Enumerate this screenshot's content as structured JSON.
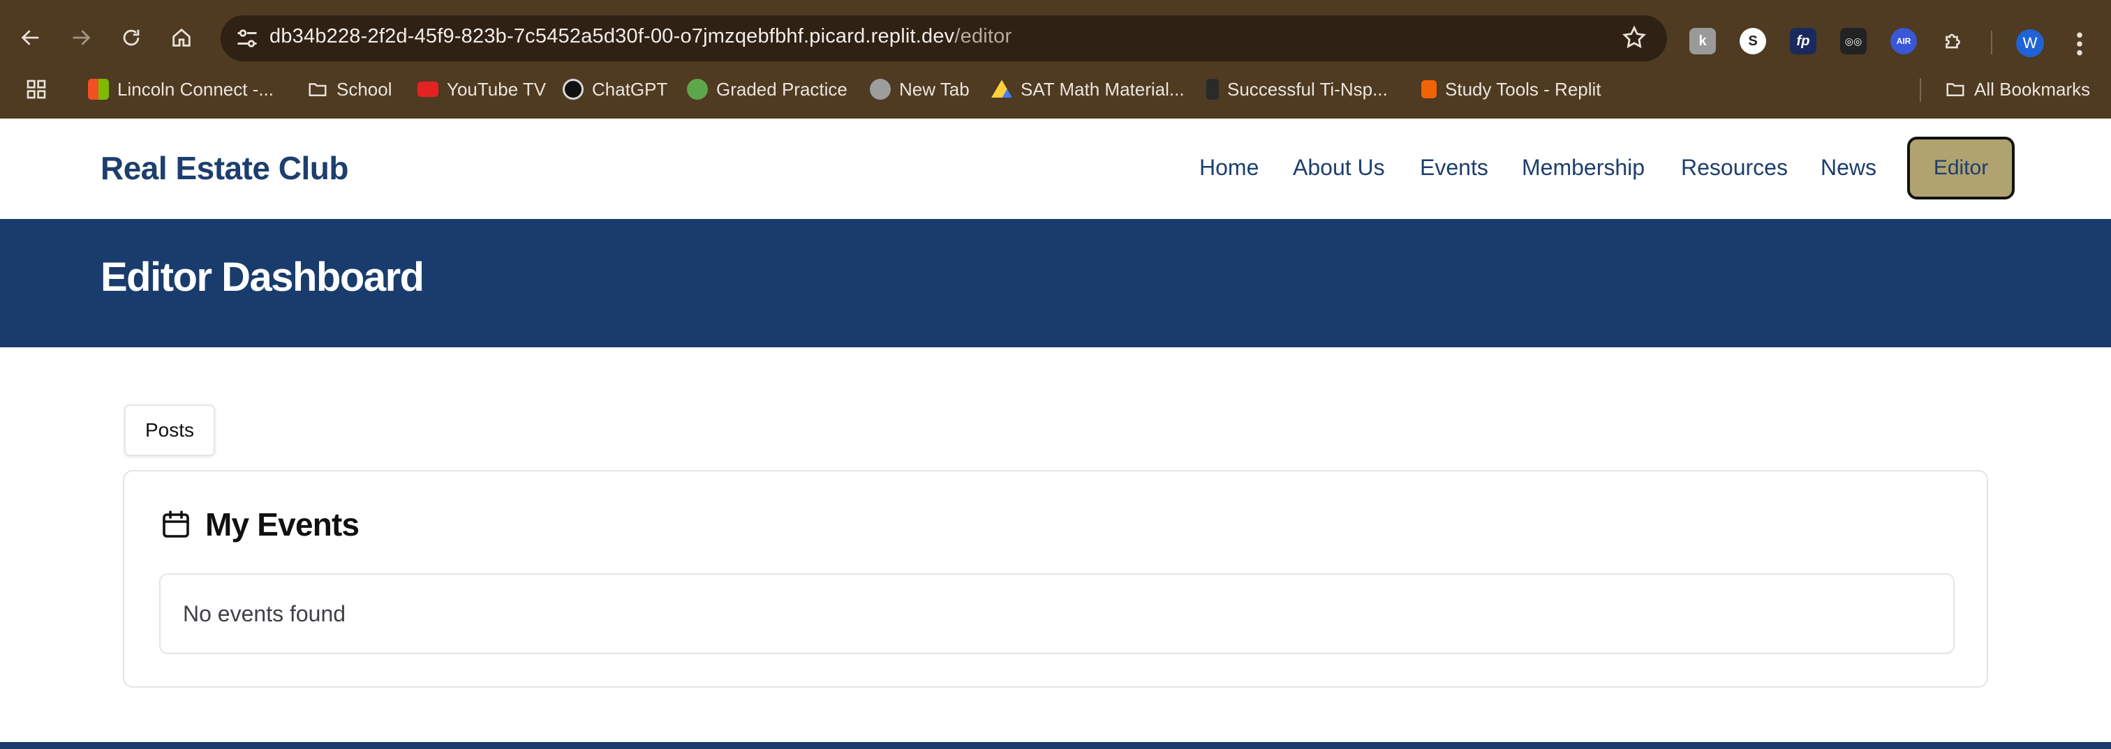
{
  "browser": {
    "url_host": "db34b228-2f2d-45f9-823b-7c5452a5d30f-00-o7jmzqebfbhf.picard.replit.dev",
    "url_path": "/editor",
    "profile_initial": "W",
    "bookmarks": [
      {
        "label": "Lincoln Connect -...",
        "icon": "microsoft-icon"
      },
      {
        "label": "School",
        "icon": "folder-icon"
      },
      {
        "label": "YouTube TV",
        "icon": "youtube-icon"
      },
      {
        "label": "ChatGPT",
        "icon": "chatgpt-icon"
      },
      {
        "label": "Graded Practice",
        "icon": "frog-icon"
      },
      {
        "label": "New Tab",
        "icon": "globe-icon"
      },
      {
        "label": "SAT Math Material...",
        "icon": "drive-icon"
      },
      {
        "label": "Successful Ti-Nsp...",
        "icon": "calculator-icon"
      },
      {
        "label": "Study Tools - Replit",
        "icon": "replit-icon"
      }
    ],
    "all_bookmarks_label": "All Bookmarks",
    "extensions": [
      {
        "name": "k-extension-icon",
        "glyph": "k",
        "color": "#9a9a9a"
      },
      {
        "name": "s-extension-icon",
        "glyph": "S",
        "color": "#ffffff"
      },
      {
        "name": "fp-extension-icon",
        "glyph": "fp",
        "color": "#1b2a5c"
      },
      {
        "name": "glasses-extension-icon",
        "glyph": "◎◎",
        "color": "#222222"
      },
      {
        "name": "air-extension-icon",
        "glyph": "AIR",
        "color": "#3957d6"
      }
    ]
  },
  "site": {
    "brand": "Real Estate Club",
    "nav": [
      {
        "label": "Home"
      },
      {
        "label": "About Us"
      },
      {
        "label": "Events"
      },
      {
        "label": "Membership"
      },
      {
        "label": "Resources"
      },
      {
        "label": "News"
      }
    ],
    "editor_button": "Editor",
    "colors": {
      "navy": "#193c6d",
      "gold": "#b0a36f"
    }
  },
  "hero": {
    "title": "Editor Dashboard"
  },
  "content": {
    "tab_label": "Posts",
    "card_title": "My Events",
    "empty_message": "No events found"
  }
}
